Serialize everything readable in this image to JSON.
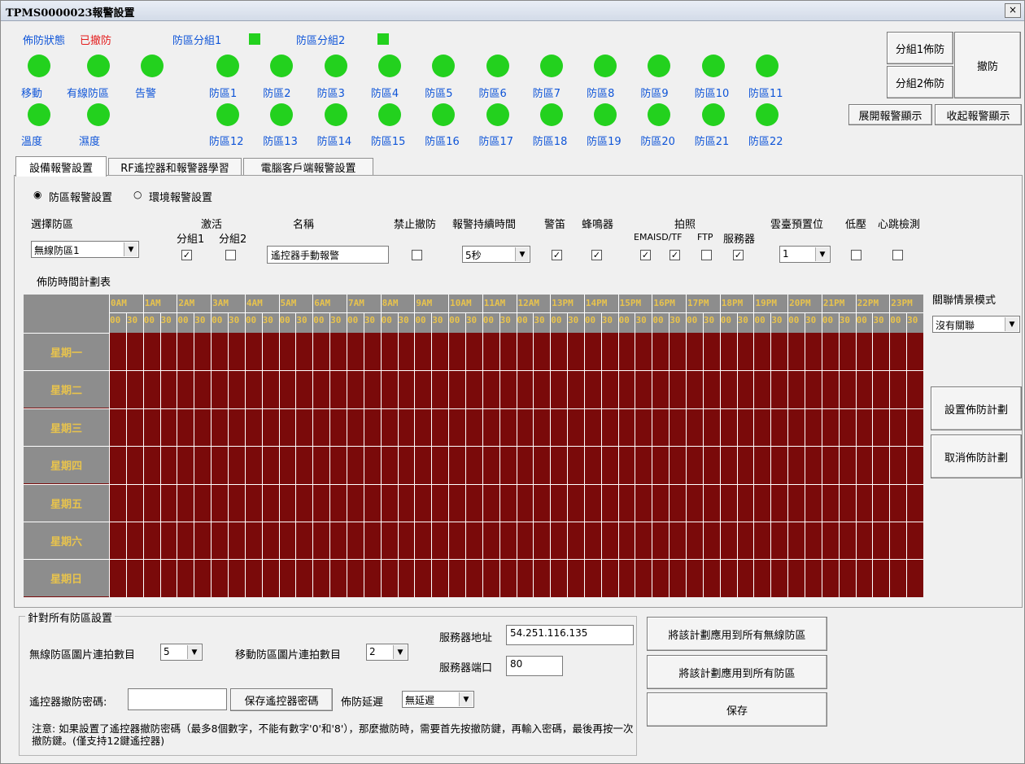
{
  "window": {
    "title": "TPMS0000023報警設置",
    "close": "×"
  },
  "status": {
    "arm_label": "佈防狀態",
    "arm_value": "已撤防",
    "group1_label": "防區分組1",
    "group2_label": "防區分組2",
    "row1_sensors": [
      "移動",
      "有線防區",
      "告警"
    ],
    "row2_sensors": [
      "溫度",
      "濕度"
    ],
    "zones_row1": [
      "防區1",
      "防區2",
      "防區3",
      "防區4",
      "防區5",
      "防區6",
      "防區7",
      "防區8",
      "防區9",
      "防區10",
      "防區11"
    ],
    "zones_row2": [
      "防區12",
      "防區13",
      "防區14",
      "防區15",
      "防區16",
      "防區17",
      "防區18",
      "防區19",
      "防區20",
      "防區21",
      "防區22"
    ],
    "led_color": "#23d11e"
  },
  "buttons": {
    "group1_arm": "分組1佈防",
    "group2_arm": "分組2佈防",
    "disarm": "撤防",
    "expand_alarm": "展開報警顯示",
    "collapse_alarm": "收起報警顯示",
    "set_schedule": "設置佈防計劃",
    "cancel_schedule": "取消佈防計劃",
    "apply_wireless": "將該計劃應用到所有無線防區",
    "apply_all": "將該計劃應用到所有防區",
    "save": "保存",
    "save_remote_pwd": "保存遙控器密碼"
  },
  "tabs": [
    "設備報警設置",
    "RF遙控器和報警器學習",
    "電腦客戶端報警設置"
  ],
  "mode": {
    "zone_alarm": "防區報警設置",
    "env_alarm": "環境報警設置",
    "selected": "zone_alarm"
  },
  "columns": {
    "select_zone": "選擇防區",
    "activate": "激活",
    "group1": "分組1",
    "group2": "分組2",
    "name": "名稱",
    "no_disarm": "禁止撤防",
    "duration": "報警持續時間",
    "siren": "警笛",
    "buzzer": "蜂鳴器",
    "photo": "拍照",
    "email_sd": "EMAISD/TF",
    "ftp": "FTP",
    "server": "服務器",
    "ptz_preset": "雲臺預置位",
    "low_voltage": "低壓",
    "heartbeat": "心跳檢測"
  },
  "values": {
    "zone": "無線防區1",
    "group1": true,
    "group2": false,
    "name": "遙控器手動報警",
    "no_disarm": false,
    "duration": "5秒",
    "siren": true,
    "buzzer": true,
    "email_sd": true,
    "tf": true,
    "ftp": false,
    "server": true,
    "ptz_preset": "1",
    "low_voltage": false,
    "heartbeat": false
  },
  "schedule": {
    "label": "佈防時間計劃表",
    "hours": [
      "0AM",
      "1AM",
      "2AM",
      "3AM",
      "4AM",
      "5AM",
      "6AM",
      "7AM",
      "8AM",
      "9AM",
      "10AM",
      "11AM",
      "12AM",
      "13PM",
      "14PM",
      "15PM",
      "16PM",
      "17PM",
      "18PM",
      "19PM",
      "20PM",
      "21PM",
      "22PM",
      "23PM"
    ],
    "minutes": [
      "00",
      "30"
    ],
    "days": [
      "星期一",
      "星期二",
      "星期三",
      "星期四",
      "星期五",
      "星期六",
      "星期日"
    ],
    "armed_color": "#7a0a0a",
    "header_color": "#8d8d8d",
    "label_color": "#e8c34d"
  },
  "scene": {
    "label": "關聯情景模式",
    "value": "沒有關聯"
  },
  "all_zones": {
    "legend": "針對所有防區設置",
    "wireless_burst_label": "無線防區圖片連拍數目",
    "wireless_burst_value": "5",
    "motion_burst_label": "移動防區圖片連拍數目",
    "motion_burst_value": "2",
    "server_addr_label": "服務器地址",
    "server_addr_value": "54.251.116.135",
    "server_port_label": "服務器端口",
    "server_port_value": "80",
    "remote_pwd_label": "遙控器撤防密碼:",
    "remote_pwd_value": "",
    "arm_delay_label": "佈防延遲",
    "arm_delay_value": "無延遲",
    "note": "注意: 如果設置了遙控器撤防密碼（最多8個數字，不能有數字'0'和'8'），那麼撤防時，需要首先按撤防鍵，再輸入密碼，最後再按一次撤防鍵。(僅支持12鍵遙控器)"
  }
}
